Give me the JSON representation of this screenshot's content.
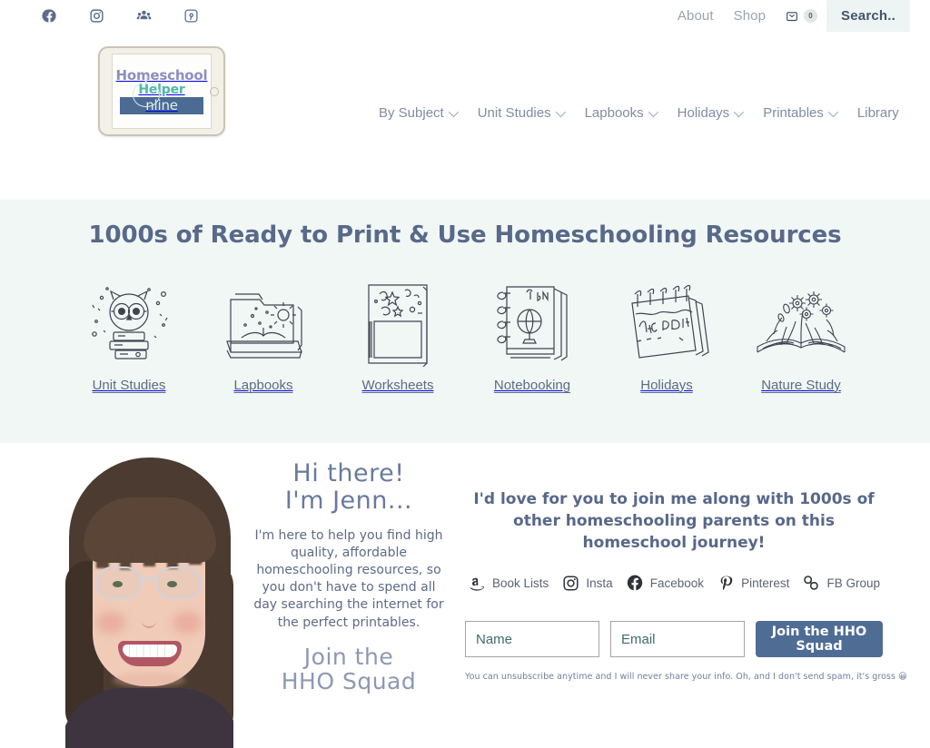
{
  "topbar": {
    "social": [
      {
        "name": "facebook-icon",
        "label": "Facebook"
      },
      {
        "name": "instagram-icon",
        "label": "Instagram"
      },
      {
        "name": "fb-group-icon",
        "label": "Facebook Group"
      },
      {
        "name": "pinterest-icon",
        "label": "Pinterest"
      }
    ],
    "links": [
      {
        "label": "About"
      },
      {
        "label": "Shop"
      }
    ],
    "cart": {
      "icon": "cart-icon",
      "count": "0"
    },
    "search_label": "Search.."
  },
  "logo": {
    "line1": "Homeschool",
    "line2": "Helper",
    "line3": "nline",
    "colors": {
      "line1": "#8b8fc0",
      "line2": "#4fb6ae",
      "band": "#4b6a94"
    }
  },
  "mainnav": {
    "items": [
      {
        "label": "By Subject",
        "has_dropdown": true
      },
      {
        "label": "Unit Studies",
        "has_dropdown": true
      },
      {
        "label": "Lapbooks",
        "has_dropdown": true
      },
      {
        "label": "Holidays",
        "has_dropdown": true
      },
      {
        "label": "Printables",
        "has_dropdown": true
      },
      {
        "label": "Library",
        "has_dropdown": false
      }
    ]
  },
  "hero": {
    "title": "1000s of Ready to Print & Use Homeschooling Resources",
    "background": "#f1f7f5",
    "categories": [
      {
        "label": "Unit Studies",
        "icon": "owl-on-books-icon"
      },
      {
        "label": "Lapbooks",
        "icon": "open-folder-book-icon"
      },
      {
        "label": "Worksheets",
        "icon": "worksheet-page-icon"
      },
      {
        "label": "Notebooking",
        "icon": "spiral-notebook-icon"
      },
      {
        "label": "Holidays",
        "icon": "holiday-calendar-icon"
      },
      {
        "label": "Nature Study",
        "icon": "open-book-flowers-icon"
      }
    ]
  },
  "jenn": {
    "greeting_line1": "Hi there!",
    "greeting_line2": "I'm Jenn...",
    "body": "I'm here to help you find high quality, affordable homeschooling resources, so you don't have to spend all day searching the internet for the perfect printables.",
    "cta_line1": "Join the",
    "cta_line2": "HHO Squad",
    "photo_alt": "jenn-portrait"
  },
  "signup": {
    "headline": "I'd love for you to join me along with 1000s of other homeschooling parents on this homeschool journey!",
    "social": [
      {
        "label": "Book Lists",
        "icon": "amazon-icon"
      },
      {
        "label": "Insta",
        "icon": "instagram-icon"
      },
      {
        "label": "Facebook",
        "icon": "facebook-icon"
      },
      {
        "label": "Pinterest",
        "icon": "pinterest-icon"
      },
      {
        "label": "FB Group",
        "icon": "link-chain-icon"
      }
    ],
    "name_placeholder": "Name",
    "name_value": "",
    "email_placeholder": "Email",
    "email_value": "",
    "submit_label": "Join the HHO Squad",
    "submit_color": "#4f6d94",
    "disclaimer": "You can unsubscribe anytime and I will never share your info. Oh, and I don't send spam, it's gross 😀"
  }
}
